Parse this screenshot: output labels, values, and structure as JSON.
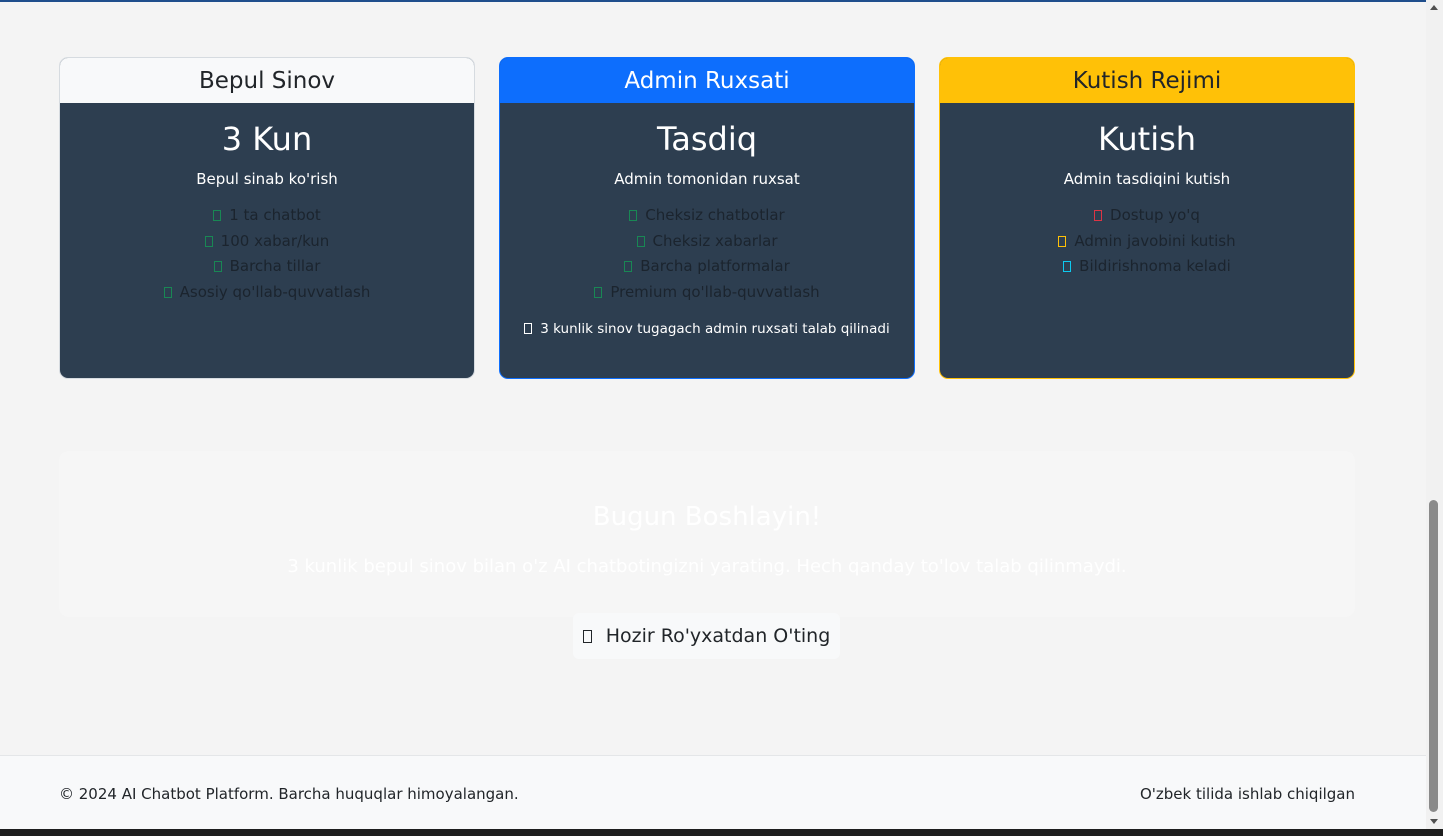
{
  "cards": [
    {
      "header": "Bepul Sinov",
      "value": "3 Kun",
      "subtitle": "Bepul sinab ko'rish",
      "features": [
        {
          "icon": "check-square-icon",
          "color": "green",
          "text": "1 ta chatbot"
        },
        {
          "icon": "check-square-icon",
          "color": "green",
          "text": "100 xabar/kun"
        },
        {
          "icon": "check-square-icon",
          "color": "green",
          "text": "Barcha tillar"
        },
        {
          "icon": "check-square-icon",
          "color": "green",
          "text": "Asosiy qo'llab-quvvatlash"
        }
      ]
    },
    {
      "header": "Admin Ruxsati",
      "value": "Tasdiq",
      "subtitle": "Admin tomonidan ruxsat",
      "features": [
        {
          "icon": "check-square-icon",
          "color": "green",
          "text": "Cheksiz chatbotlar"
        },
        {
          "icon": "check-square-icon",
          "color": "green",
          "text": "Cheksiz xabarlar"
        },
        {
          "icon": "check-square-icon",
          "color": "green",
          "text": "Barcha platformalar"
        },
        {
          "icon": "check-square-icon",
          "color": "green",
          "text": "Premium qo'llab-quvvatlash"
        }
      ],
      "note": "3 kunlik sinov tugagach admin ruxsati talab qilinadi"
    },
    {
      "header": "Kutish Rejimi",
      "value": "Kutish",
      "subtitle": "Admin tasdiqini kutish",
      "features": [
        {
          "icon": "x-square-icon",
          "color": "red",
          "text": "Dostup yo'q"
        },
        {
          "icon": "clock-square-icon",
          "color": "yellow",
          "text": "Admin javobini kutish"
        },
        {
          "icon": "bell-square-icon",
          "color": "cyan",
          "text": "Bildirishnoma keladi"
        }
      ]
    }
  ],
  "cta": {
    "title": "Bugun Boshlayin!",
    "text": "3 kunlik bepul sinov bilan o'z AI chatbotingizni yarating. Hech qanday to'lov talab qilinmaydi.",
    "button": "Hozir Ro'yxatdan O'ting"
  },
  "footer": {
    "left": "© 2024 AI Chatbot Platform. Barcha huquqlar himoyalangan.",
    "right": "O'zbek tilida ishlab chiqilgan"
  },
  "colors": {
    "primary": "#0d6efd",
    "warning": "#ffc107",
    "card_body": "#2d3e50",
    "success": "#198754",
    "danger": "#dc3545",
    "info": "#0dcaf0"
  }
}
